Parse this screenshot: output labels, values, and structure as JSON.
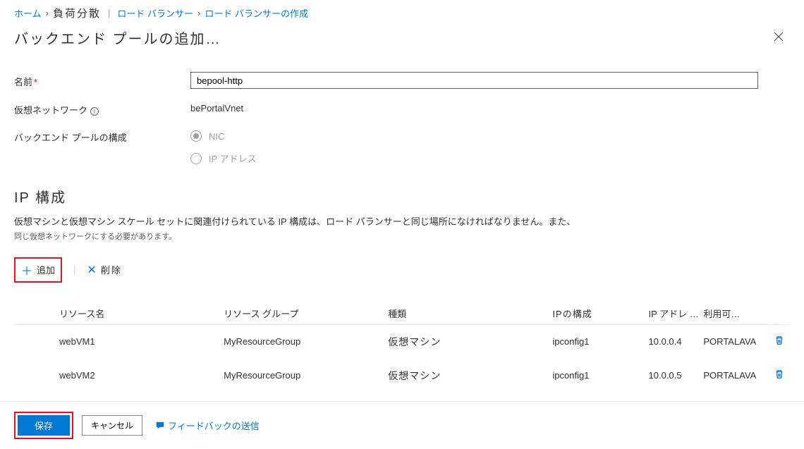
{
  "breadcrumb": {
    "home": "ホーム",
    "head": "負荷分散",
    "lb": "ロード バランサー",
    "create": "ロード バランサーの作成"
  },
  "title": "バックエンド プールの追加…",
  "form": {
    "name_label": "名前",
    "name_value": "bepool-http",
    "vnet_label": "仮想ネットワーク",
    "vnet_value": "bePortalVnet",
    "config_label": "バックエンド プールの構成",
    "radio_nic": "NIC",
    "radio_ip": "IP アドレス"
  },
  "ip_section": {
    "title": "IP 構成",
    "desc": "仮想マシンと仮想マシン スケール セットに関連付けられている IP 構成は、ロード バランサーと同じ場所になければなりません。また、",
    "desc2": "同じ仮想ネットワークにする必要があります。"
  },
  "toolbar": {
    "add": "追加",
    "delete": "削除"
  },
  "table": {
    "h_name": "リソース名",
    "h_rg": "リソース グループ",
    "h_type": "種類",
    "h_ipc": "IPの構成",
    "h_ipa": "IP アドレ …",
    "h_net": "利用可…",
    "rows": [
      {
        "name": "webVM1",
        "rg": "MyResourceGroup",
        "type": "仮想マシン",
        "ipc": "ipconfig1",
        "ipa": "10.0.0.4",
        "net": "PORTALAVA"
      },
      {
        "name": "webVM2",
        "rg": "MyResourceGroup",
        "type": "仮想マシン",
        "ipc": "ipconfig1",
        "ipa": "10.0.0.5",
        "net": "PORTALAVA"
      }
    ]
  },
  "footer": {
    "save": "保存",
    "cancel": "キャンセル",
    "feedback": "フィードバックの送信"
  }
}
